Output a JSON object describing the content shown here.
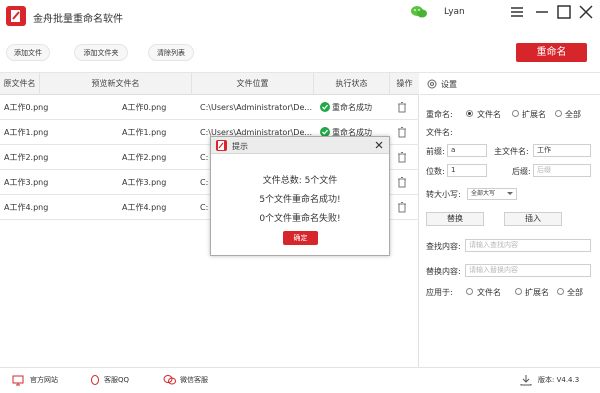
{
  "app": {
    "title": "金舟批量重命名软件",
    "user": "Lyan"
  },
  "toolbar": {
    "add_file": "添加文件",
    "add_folder": "添加文件夹",
    "clear_list": "清除列表",
    "rename": "重命名"
  },
  "table": {
    "headers": [
      "原文件名",
      "预览新文件名",
      "文件位置",
      "执行状态",
      "操作"
    ],
    "rows": [
      {
        "orig": "A工作0.png",
        "preview": "A工作0.png",
        "path": "C:\\Users\\Administrator\\De...",
        "status": "重命名成功"
      },
      {
        "orig": "A工作1.png",
        "preview": "A工作1.png",
        "path": "C:\\Users\\Administrator\\De...",
        "status": "重命名成功"
      },
      {
        "orig": "A工作2.png",
        "preview": "A工作2.png",
        "path": "C:",
        "status": ""
      },
      {
        "orig": "A工作3.png",
        "preview": "A工作3.png",
        "path": "C:",
        "status": ""
      },
      {
        "orig": "A工作4.png",
        "preview": "A工作4.png",
        "path": "C:",
        "status": ""
      }
    ]
  },
  "panel": {
    "title": "设置",
    "rename_label": "重命名:",
    "rename_options": [
      "文件名",
      "扩展名",
      "全部"
    ],
    "rename_selected": "文件名",
    "filename_label": "文件名:",
    "prefix_label": "前缀:",
    "prefix_value": "a",
    "main_name_label": "主文件名:",
    "main_name_value": "工作",
    "digits_label": "位数:",
    "digits_value": "1",
    "suffix_label": "后缀:",
    "suffix_placeholder": "后缀",
    "case_label": "转大小写:",
    "case_value": "全部大写",
    "replace_btn": "替换",
    "insert_btn": "插入",
    "find_label": "查找内容:",
    "find_placeholder": "请输入查找内容",
    "replace_label": "替换内容:",
    "replace_placeholder": "请输入替换内容",
    "apply_label": "应用于:",
    "apply_options": [
      "文件名",
      "扩展名",
      "全部"
    ]
  },
  "footer": {
    "website": "官方网站",
    "qq": "客服QQ",
    "wechat": "微信客服",
    "version": "版本: V4.4.3"
  },
  "dialog": {
    "title": "提示",
    "line1": "文件总数: 5个文件",
    "line2": "5个文件重命名成功!",
    "line3": "0个文件重命名失败!",
    "ok": "确定"
  },
  "colors": {
    "accent": "#d7262b",
    "success": "#22a845"
  }
}
